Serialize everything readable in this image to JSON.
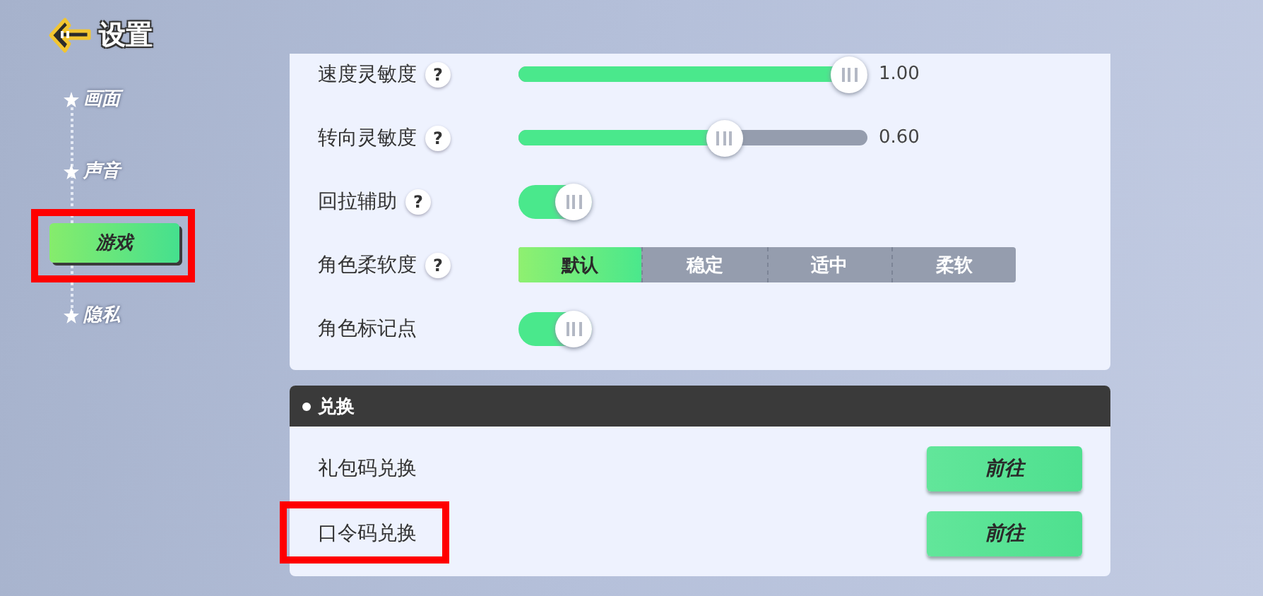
{
  "header": {
    "title": "设置"
  },
  "sidebar": {
    "items": [
      {
        "label": "画面",
        "selected": false,
        "highlighted": false
      },
      {
        "label": "声音",
        "selected": false,
        "highlighted": false
      },
      {
        "label": "游戏",
        "selected": true,
        "highlighted": true
      },
      {
        "label": "隐私",
        "selected": false,
        "highlighted": false
      }
    ]
  },
  "game_settings": {
    "rows": [
      {
        "kind": "slider",
        "label": "速度灵敏度",
        "help": "?",
        "level": 1.0,
        "reading": "1.00"
      },
      {
        "kind": "slider",
        "label": "转向灵敏度",
        "help": "?",
        "level": 0.6,
        "reading": "0.60"
      },
      {
        "kind": "toggle",
        "label": "回拉辅助",
        "help": "?",
        "on": true
      },
      {
        "kind": "segmented",
        "label": "角色柔软度",
        "help": "?",
        "options": [
          {
            "label": "默认",
            "selected": true
          },
          {
            "label": "稳定",
            "selected": false
          },
          {
            "label": "适中",
            "selected": false
          },
          {
            "label": "柔软",
            "selected": false
          }
        ]
      },
      {
        "kind": "toggle",
        "label": "角色标记点",
        "on": true
      }
    ]
  },
  "redeem": {
    "title": "兑换",
    "rows": [
      {
        "label": "礼包码兑换",
        "button": "前往",
        "highlighted": false
      },
      {
        "label": "口令码兑换",
        "button": "前往",
        "highlighted": true
      }
    ]
  }
}
